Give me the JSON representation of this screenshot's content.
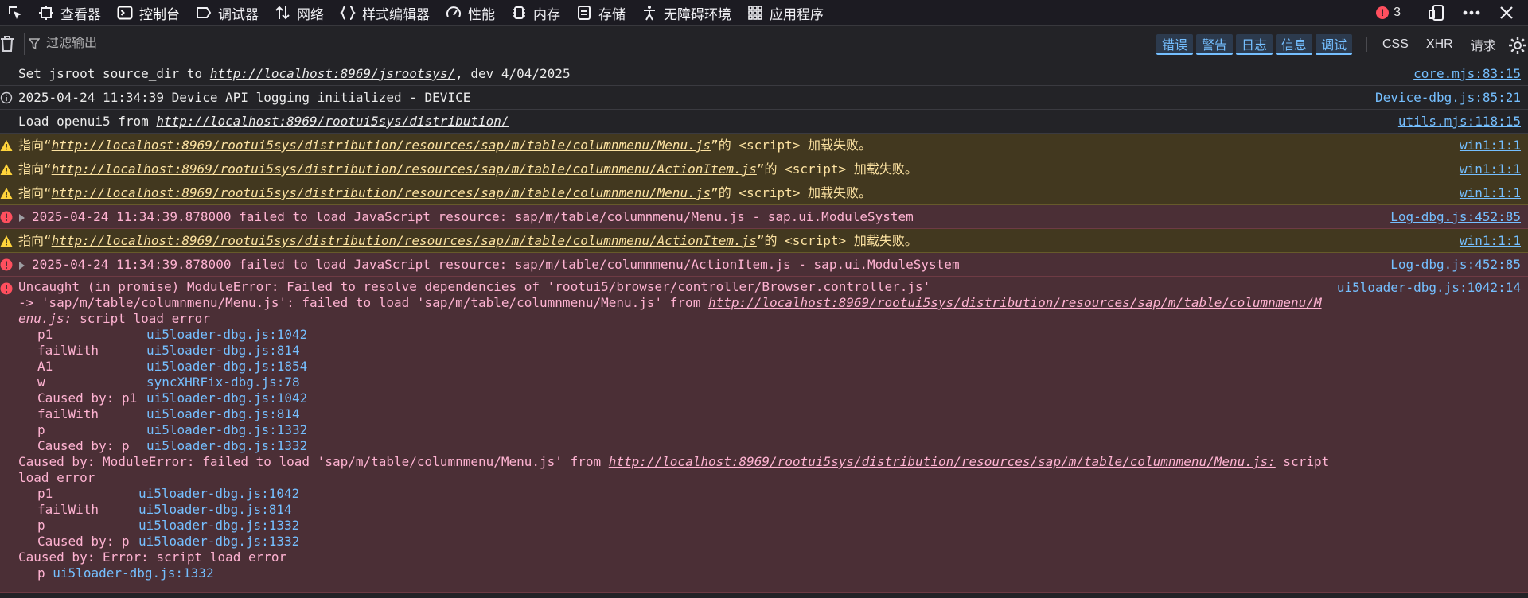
{
  "tabs": [
    {
      "label": "查看器",
      "icon": "inspector-icon"
    },
    {
      "label": "控制台",
      "icon": "console-icon",
      "selected": true
    },
    {
      "label": "调试器",
      "icon": "debugger-icon"
    },
    {
      "label": "网络",
      "icon": "network-icon"
    },
    {
      "label": "样式编辑器",
      "icon": "style-editor-icon"
    },
    {
      "label": "性能",
      "icon": "performance-icon"
    },
    {
      "label": "内存",
      "icon": "memory-icon"
    },
    {
      "label": "存储",
      "icon": "storage-icon"
    },
    {
      "label": "无障碍环境",
      "icon": "accessibility-icon"
    },
    {
      "label": "应用程序",
      "icon": "application-icon"
    }
  ],
  "error_count": "3",
  "toolbar": {
    "filter_placeholder": "过滤输出",
    "levels": [
      "错误",
      "警告",
      "日志",
      "信息",
      "调试"
    ],
    "categories": [
      "CSS",
      "XHR",
      "请求"
    ]
  },
  "messages": {
    "m1": {
      "pre": "Set jsroot source_dir to ",
      "url": "http://localhost:8969/jsrootsys/",
      "post": ", dev 4/04/2025",
      "loc": "core.mjs:83:15"
    },
    "m2": {
      "text": "2025-04-24 11:34:39 Device API logging initialized - DEVICE",
      "loc": "Device-dbg.js:85:21"
    },
    "m3": {
      "pre": "Load openui5 from ",
      "url": "http://localhost:8969/rootui5sys/distribution/",
      "loc": "utils.mjs:118:15"
    },
    "m4": {
      "pre": "指向“",
      "url": "http://localhost:8969/rootui5sys/distribution/resources/sap/m/table/columnmenu/Menu.js",
      "post": "”的 <script> 加载失败。",
      "loc": "win1:1:1"
    },
    "m5": {
      "pre": "指向“",
      "url": "http://localhost:8969/rootui5sys/distribution/resources/sap/m/table/columnmenu/ActionItem.js",
      "post": "”的 <script> 加载失败。",
      "loc": "win1:1:1"
    },
    "m6": {
      "pre": "指向“",
      "url": "http://localhost:8969/rootui5sys/distribution/resources/sap/m/table/columnmenu/Menu.js",
      "post": "”的 <script> 加载失败。",
      "loc": "win1:1:1"
    },
    "m7": {
      "text": "2025-04-24 11:34:39.878000 failed to load JavaScript resource: sap/m/table/columnmenu/Menu.js -  sap.ui.ModuleSystem",
      "loc": "Log-dbg.js:452:85"
    },
    "m8": {
      "pre": "指向“",
      "url": "http://localhost:8969/rootui5sys/distribution/resources/sap/m/table/columnmenu/ActionItem.js",
      "post": "”的 <script> 加载失败。",
      "loc": "win1:1:1"
    },
    "m9": {
      "text": "2025-04-24 11:34:39.878000 failed to load JavaScript resource: sap/m/table/columnmenu/ActionItem.js -  sap.ui.ModuleSystem",
      "loc": "Log-dbg.js:452:85"
    },
    "m10": {
      "loc": "ui5loader-dbg.js:1042:14",
      "line1": "Uncaught (in promise) ModuleError: Failed to resolve dependencies of 'rootui5/browser/controller/Browser.controller.js'",
      "line2_pre": " -> 'sap/m/table/columnmenu/Menu.js': failed to load 'sap/m/table/columnmenu/Menu.js' from ",
      "line2_url": "http://localhost:8969/rootui5sys/distribution/resources/sap/m/table/columnmenu/M",
      "line3_url": "enu.js:",
      "line3_post": " script load error",
      "stack1": [
        {
          "fn": "p1",
          "file": "ui5loader-dbg.js:1042"
        },
        {
          "fn": "failWith",
          "file": "ui5loader-dbg.js:814"
        },
        {
          "fn": "A1",
          "file": "ui5loader-dbg.js:1854"
        },
        {
          "fn": "w",
          "file": "syncXHRFix-dbg.js:78"
        },
        {
          "fn": "Caused by: p1",
          "file": "ui5loader-dbg.js:1042"
        },
        {
          "fn": "failWith",
          "file": "ui5loader-dbg.js:814"
        },
        {
          "fn": "p",
          "file": "ui5loader-dbg.js:1332"
        },
        {
          "fn": "Caused by: p",
          "file": "ui5loader-dbg.js:1332"
        }
      ],
      "caused1_pre": "Caused by: ModuleError: failed to load 'sap/m/table/columnmenu/Menu.js' from ",
      "caused1_url": "http://localhost:8969/rootui5sys/distribution/resources/sap/m/table/columnmenu/Menu.js:",
      "caused1_post": " script",
      "caused1_line2": "load error",
      "stack2": [
        {
          "fn": "p1",
          "file": "ui5loader-dbg.js:1042"
        },
        {
          "fn": "failWith",
          "file": "ui5loader-dbg.js:814"
        },
        {
          "fn": "p",
          "file": "ui5loader-dbg.js:1332"
        },
        {
          "fn": "Caused by: p",
          "file": "ui5loader-dbg.js:1332"
        }
      ],
      "caused2": "Caused by: Error: script load error",
      "stack3": {
        "fn": "p",
        "file": "ui5loader-dbg.js:1332"
      }
    }
  }
}
